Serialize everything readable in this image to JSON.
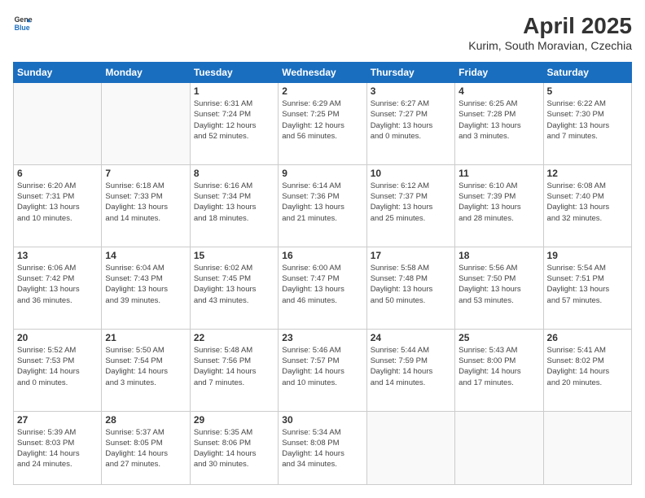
{
  "header": {
    "logo_line1": "General",
    "logo_line2": "Blue",
    "title": "April 2025",
    "subtitle": "Kurim, South Moravian, Czechia"
  },
  "days_of_week": [
    "Sunday",
    "Monday",
    "Tuesday",
    "Wednesday",
    "Thursday",
    "Friday",
    "Saturday"
  ],
  "weeks": [
    [
      {
        "day": "",
        "info": ""
      },
      {
        "day": "",
        "info": ""
      },
      {
        "day": "1",
        "info": "Sunrise: 6:31 AM\nSunset: 7:24 PM\nDaylight: 12 hours\nand 52 minutes."
      },
      {
        "day": "2",
        "info": "Sunrise: 6:29 AM\nSunset: 7:25 PM\nDaylight: 12 hours\nand 56 minutes."
      },
      {
        "day": "3",
        "info": "Sunrise: 6:27 AM\nSunset: 7:27 PM\nDaylight: 13 hours\nand 0 minutes."
      },
      {
        "day": "4",
        "info": "Sunrise: 6:25 AM\nSunset: 7:28 PM\nDaylight: 13 hours\nand 3 minutes."
      },
      {
        "day": "5",
        "info": "Sunrise: 6:22 AM\nSunset: 7:30 PM\nDaylight: 13 hours\nand 7 minutes."
      }
    ],
    [
      {
        "day": "6",
        "info": "Sunrise: 6:20 AM\nSunset: 7:31 PM\nDaylight: 13 hours\nand 10 minutes."
      },
      {
        "day": "7",
        "info": "Sunrise: 6:18 AM\nSunset: 7:33 PM\nDaylight: 13 hours\nand 14 minutes."
      },
      {
        "day": "8",
        "info": "Sunrise: 6:16 AM\nSunset: 7:34 PM\nDaylight: 13 hours\nand 18 minutes."
      },
      {
        "day": "9",
        "info": "Sunrise: 6:14 AM\nSunset: 7:36 PM\nDaylight: 13 hours\nand 21 minutes."
      },
      {
        "day": "10",
        "info": "Sunrise: 6:12 AM\nSunset: 7:37 PM\nDaylight: 13 hours\nand 25 minutes."
      },
      {
        "day": "11",
        "info": "Sunrise: 6:10 AM\nSunset: 7:39 PM\nDaylight: 13 hours\nand 28 minutes."
      },
      {
        "day": "12",
        "info": "Sunrise: 6:08 AM\nSunset: 7:40 PM\nDaylight: 13 hours\nand 32 minutes."
      }
    ],
    [
      {
        "day": "13",
        "info": "Sunrise: 6:06 AM\nSunset: 7:42 PM\nDaylight: 13 hours\nand 36 minutes."
      },
      {
        "day": "14",
        "info": "Sunrise: 6:04 AM\nSunset: 7:43 PM\nDaylight: 13 hours\nand 39 minutes."
      },
      {
        "day": "15",
        "info": "Sunrise: 6:02 AM\nSunset: 7:45 PM\nDaylight: 13 hours\nand 43 minutes."
      },
      {
        "day": "16",
        "info": "Sunrise: 6:00 AM\nSunset: 7:47 PM\nDaylight: 13 hours\nand 46 minutes."
      },
      {
        "day": "17",
        "info": "Sunrise: 5:58 AM\nSunset: 7:48 PM\nDaylight: 13 hours\nand 50 minutes."
      },
      {
        "day": "18",
        "info": "Sunrise: 5:56 AM\nSunset: 7:50 PM\nDaylight: 13 hours\nand 53 minutes."
      },
      {
        "day": "19",
        "info": "Sunrise: 5:54 AM\nSunset: 7:51 PM\nDaylight: 13 hours\nand 57 minutes."
      }
    ],
    [
      {
        "day": "20",
        "info": "Sunrise: 5:52 AM\nSunset: 7:53 PM\nDaylight: 14 hours\nand 0 minutes."
      },
      {
        "day": "21",
        "info": "Sunrise: 5:50 AM\nSunset: 7:54 PM\nDaylight: 14 hours\nand 3 minutes."
      },
      {
        "day": "22",
        "info": "Sunrise: 5:48 AM\nSunset: 7:56 PM\nDaylight: 14 hours\nand 7 minutes."
      },
      {
        "day": "23",
        "info": "Sunrise: 5:46 AM\nSunset: 7:57 PM\nDaylight: 14 hours\nand 10 minutes."
      },
      {
        "day": "24",
        "info": "Sunrise: 5:44 AM\nSunset: 7:59 PM\nDaylight: 14 hours\nand 14 minutes."
      },
      {
        "day": "25",
        "info": "Sunrise: 5:43 AM\nSunset: 8:00 PM\nDaylight: 14 hours\nand 17 minutes."
      },
      {
        "day": "26",
        "info": "Sunrise: 5:41 AM\nSunset: 8:02 PM\nDaylight: 14 hours\nand 20 minutes."
      }
    ],
    [
      {
        "day": "27",
        "info": "Sunrise: 5:39 AM\nSunset: 8:03 PM\nDaylight: 14 hours\nand 24 minutes."
      },
      {
        "day": "28",
        "info": "Sunrise: 5:37 AM\nSunset: 8:05 PM\nDaylight: 14 hours\nand 27 minutes."
      },
      {
        "day": "29",
        "info": "Sunrise: 5:35 AM\nSunset: 8:06 PM\nDaylight: 14 hours\nand 30 minutes."
      },
      {
        "day": "30",
        "info": "Sunrise: 5:34 AM\nSunset: 8:08 PM\nDaylight: 14 hours\nand 34 minutes."
      },
      {
        "day": "",
        "info": ""
      },
      {
        "day": "",
        "info": ""
      },
      {
        "day": "",
        "info": ""
      }
    ]
  ]
}
